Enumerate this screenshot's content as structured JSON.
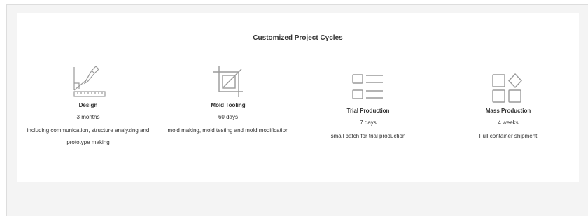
{
  "section": {
    "title": "Customized Project Cycles"
  },
  "stages": [
    {
      "icon": "design-ruler-pen-icon",
      "name": "Design",
      "duration": "3 months",
      "description": "including communication, structure analyzing and prototype making"
    },
    {
      "icon": "crop-tooling-icon",
      "name": "Mold Tooling",
      "duration": "60 days",
      "description": "mold making, mold testing and mold modification"
    },
    {
      "icon": "list-icon",
      "name": "Trial Production",
      "duration": "7 days",
      "description": "small batch for trial production"
    },
    {
      "icon": "grid-shapes-icon",
      "name": "Mass Production",
      "duration": "4 weeks",
      "description": "Full container shipment"
    }
  ],
  "colors": {
    "icon": "#9a9a9a",
    "text": "#333333",
    "background": "#f4f4f4",
    "card": "#ffffff"
  }
}
